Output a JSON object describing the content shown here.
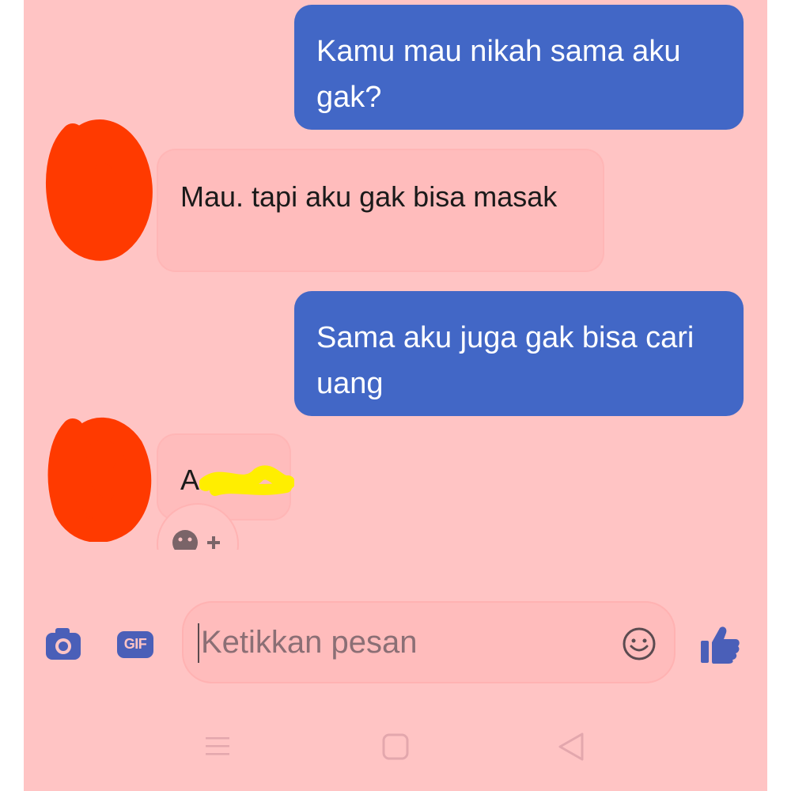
{
  "messages": [
    {
      "side": "out",
      "text": "Kamu mau nikah sama aku gak?"
    },
    {
      "side": "in",
      "text": "Mau. tapi aku gak bisa masak"
    },
    {
      "side": "out",
      "text": "Sama aku juga gak bisa cari uang"
    },
    {
      "side": "in",
      "text": "A"
    }
  ],
  "composer": {
    "placeholder": "Ketikkan pesan",
    "gif_label": "GIF"
  },
  "icons": {
    "camera": "camera-icon",
    "gif": "gif-icon",
    "emoji": "smiley-icon",
    "like": "thumbs-up-icon",
    "reaction": "add-reaction-icon",
    "nav_menu": "menu-icon",
    "nav_home": "home-square-icon",
    "nav_back": "back-triangle-icon"
  },
  "colors": {
    "background": "#ffc4c4",
    "outgoing_bubble": "#4267c6",
    "incoming_bubble": "#ffbcbc",
    "accent": "#4a5fb8",
    "scribble": "#ff3a00",
    "highlight": "#ffee00"
  }
}
